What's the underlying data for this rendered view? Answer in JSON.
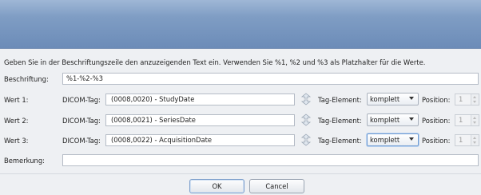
{
  "dialog": {
    "hint": "Geben Sie in der Beschriftungszeile den anzuzeigenden Text ein. Verwenden Sie %1, %2 und %3 als Platzhalter für die Werte.",
    "caption_label": "Beschriftung:",
    "caption_value": "%1-%2-%3",
    "remark_label": "Bemerkung:",
    "remark_value": ""
  },
  "rows": [
    {
      "label": "Wert 1:",
      "dicom_label": "DICOM-Tag:",
      "dicom_value": "(0008,0020) - StudyDate",
      "tag_label": "Tag-Element:",
      "tag_value": "komplett",
      "pos_label": "Position:",
      "pos_value": "1"
    },
    {
      "label": "Wert 2:",
      "dicom_label": "DICOM-Tag:",
      "dicom_value": "(0008,0021) - SeriesDate",
      "tag_label": "Tag-Element:",
      "tag_value": "komplett",
      "pos_label": "Position:",
      "pos_value": "1"
    },
    {
      "label": "Wert 3:",
      "dicom_label": "DICOM-Tag:",
      "dicom_value": "(0008,0022) - AcquisitionDate",
      "tag_label": "Tag-Element:",
      "tag_value": "komplett",
      "pos_label": "Position:",
      "pos_value": "1"
    }
  ],
  "buttons": {
    "ok": "OK",
    "cancel": "Cancel"
  },
  "icons": {
    "swap": "select-tag-icon"
  },
  "colors": {
    "titlebar": "#7f9dc4",
    "background": "#eef0f3"
  }
}
